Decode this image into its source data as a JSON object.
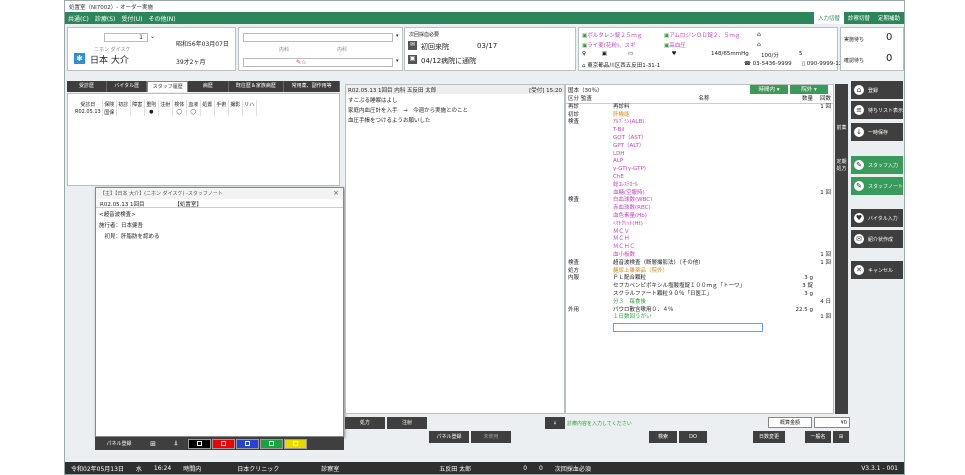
{
  "window": {
    "title": "処置室（NI7002）- オーダー実施"
  },
  "menu": {
    "items": [
      "共通(C)",
      "診療(S)",
      "受付(U)",
      "その他(N)"
    ],
    "right": [
      "入力切替",
      "診察切替",
      "定期補助"
    ]
  },
  "patient": {
    "num": "1",
    "kana": "ニホン ダイスケ",
    "name": "日本 大介",
    "dob": "昭和56年03月07日",
    "age": "39才2ヶ月",
    "dept1": "内科",
    "dept2": "内科"
  },
  "visit": {
    "label": "次回採血必要",
    "first": "初回来院",
    "first_date": "03/17",
    "next": "04/12病院に通院"
  },
  "alerts": {
    "a1": "ボルタレン錠２５ｍｇ",
    "a2": "アムロジンＯＤ錠２．５ｍｇ",
    "a3": "ライ麦(花粉)、スギ",
    "a4": "高血圧",
    "bp": "148/65mmHg",
    "pulse": "100/分",
    "pages": "5"
  },
  "contact": {
    "address": "東京都品川区西五反田1-31-1",
    "tel": "03-5436-9999",
    "mobile": "090-9999-1234"
  },
  "counters": {
    "label1": "実施待ち",
    "v1": "0",
    "label2": "確認待ち",
    "v2": "0"
  },
  "tabs": [
    "受診歴",
    "バイタル歴",
    "スタッフ履歴",
    "病歴",
    "既往歴＆家族病歴",
    "常用薬、副作用等"
  ],
  "history": {
    "headers": [
      "受診日",
      "保険",
      "初診",
      "障害",
      "重則",
      "注射",
      "検体",
      "血液",
      "処置",
      "手術",
      "撮影",
      "リハ"
    ],
    "row": [
      "R02.05.13",
      "国保",
      "",
      "",
      "●",
      "",
      "◯",
      "◯",
      "",
      "",
      "",
      ""
    ]
  },
  "note": {
    "title": "【主】【日本 大介】(ニホン ダイスケ) -スタッフノート",
    "date": "R02.05.13 1回目",
    "tag": "【処置室】",
    "lines": [
      "<超音波検査>",
      "施行者：日本健吾",
      "　初見：肝脂肪を認める"
    ]
  },
  "note_bottom": {
    "panel": "パネル登録"
  },
  "center": {
    "header": "R02.05.13 1回目 内科 五反田 太郎",
    "reception": "[受付] 15:20",
    "lines": [
      "すこぶる睡眠はよし",
      "家庭内血圧計を入手　→　今週から実施とのこと",
      "血圧手帳をつけるようお願いした"
    ],
    "bottom": [
      "処方",
      "注射",
      "パネル登録",
      "未使用"
    ]
  },
  "order": {
    "top": "国本（30％）",
    "btn1": "時間内",
    "btn2": "院外",
    "headers": [
      "区分",
      "監査",
      "名称",
      "数量",
      "回数"
    ],
    "rows": [
      {
        "k": "再診",
        "n": "再診料",
        "q": "",
        "t": "1 回",
        "cls": ""
      },
      {
        "k": "初診",
        "n": "肝機能",
        "q": "",
        "t": "",
        "cls": "org"
      },
      {
        "k": "検査",
        "n": "ｱﾙﾌﾞﾐﾝ(ALB)",
        "q": "",
        "t": "",
        "cls": "mag"
      },
      {
        "k": "",
        "n": "T-Bil",
        "q": "",
        "t": "",
        "cls": "mag"
      },
      {
        "k": "",
        "n": "GOT（AST）",
        "q": "",
        "t": "",
        "cls": "mag"
      },
      {
        "k": "",
        "n": "GPT（ALT）",
        "q": "",
        "t": "",
        "cls": "mag"
      },
      {
        "k": "",
        "n": "LDH",
        "q": "",
        "t": "",
        "cls": "mag"
      },
      {
        "k": "",
        "n": "ALP",
        "q": "",
        "t": "",
        "cls": "mag"
      },
      {
        "k": "",
        "n": "γ-GT(γ-GTP)",
        "q": "",
        "t": "",
        "cls": "mag"
      },
      {
        "k": "",
        "n": "ChE",
        "q": "",
        "t": "",
        "cls": "mag"
      },
      {
        "k": "",
        "n": "総ｺﾚｽﾃﾛｰﾙ",
        "q": "",
        "t": "",
        "cls": "mag"
      },
      {
        "k": "",
        "n": "血糖(空腹時)",
        "q": "",
        "t": "1 回",
        "cls": "mag"
      },
      {
        "k": "検査",
        "n": "白血球数(WBC)",
        "q": "",
        "t": "",
        "cls": "mag"
      },
      {
        "k": "",
        "n": "赤血球数(RBC)",
        "q": "",
        "t": "",
        "cls": "mag"
      },
      {
        "k": "",
        "n": "血色素量(Hb)",
        "q": "",
        "t": "",
        "cls": "mag"
      },
      {
        "k": "",
        "n": "ﾍﾏﾄｸﾘｯﾄ(Ht)",
        "q": "",
        "t": "",
        "cls": "mag"
      },
      {
        "k": "",
        "n": "ＭＣＶ",
        "q": "",
        "t": "",
        "cls": "mag"
      },
      {
        "k": "",
        "n": "ＭＣＨ",
        "q": "",
        "t": "",
        "cls": "mag"
      },
      {
        "k": "",
        "n": "ＭＣＨＣ",
        "q": "",
        "t": "",
        "cls": "mag"
      },
      {
        "k": "",
        "n": "血小板数",
        "q": "",
        "t": "1 回",
        "cls": "mag"
      },
      {
        "k": "検査",
        "n": "超音波検査（断層撮影法）（その他）",
        "q": "",
        "t": "1 回",
        "cls": ""
      },
      {
        "k": "処方",
        "n": "糖尿上乗薬品（院外）",
        "q": "",
        "t": "",
        "cls": "org"
      },
      {
        "k": "内服",
        "n": "ＰＬ配合顆粒",
        "q": "3 g",
        "t": "",
        "cls": ""
      },
      {
        "k": "",
        "n": "セフカペンピボキシル塩酸塩錠１００ｍｇ「トーワ」",
        "q": "3 錠",
        "t": "",
        "cls": ""
      },
      {
        "k": "",
        "n": "スクラルファート顆粒９０％「日医工」",
        "q": "3 g",
        "t": "",
        "cls": ""
      },
      {
        "k": "",
        "n": "分３　毎食後",
        "q": "",
        "t": "4 日",
        "cls": "grn"
      },
      {
        "k": "外用",
        "n": "パウロ散含嗽用０．４％",
        "q": "22.5 g",
        "t": "",
        "cls": ""
      },
      {
        "k": "",
        "n": "１日数回うがい",
        "q": "",
        "t": "1 回",
        "cls": "grn"
      }
    ],
    "hint": "診療内容を入力してください",
    "calc": "概算金額",
    "yen": "¥0",
    "bottom": [
      "検索",
      "DO",
      "日数変更",
      "一般名"
    ]
  },
  "side": {
    "b1": "登録",
    "b2": "待ちリスト表示",
    "b3": "一時保存",
    "b4": "スタッフ入力",
    "b5": "スタッフノート",
    "b6": "バイタル入力",
    "b7": "紹介状作成",
    "b8": "キャンセル",
    "v1": "前薬",
    "v2": "定期処方"
  },
  "status": {
    "date": "令和02年05月13日",
    "dow": "水",
    "time": "16:24",
    "period": "時間内",
    "clinic": "日本クリニック",
    "room": "診察室",
    "doctor": "五反田 太郎",
    "zero1": "0",
    "zero2": "0",
    "next": "次回採血必須",
    "version": "V3.3.1 - 001"
  }
}
